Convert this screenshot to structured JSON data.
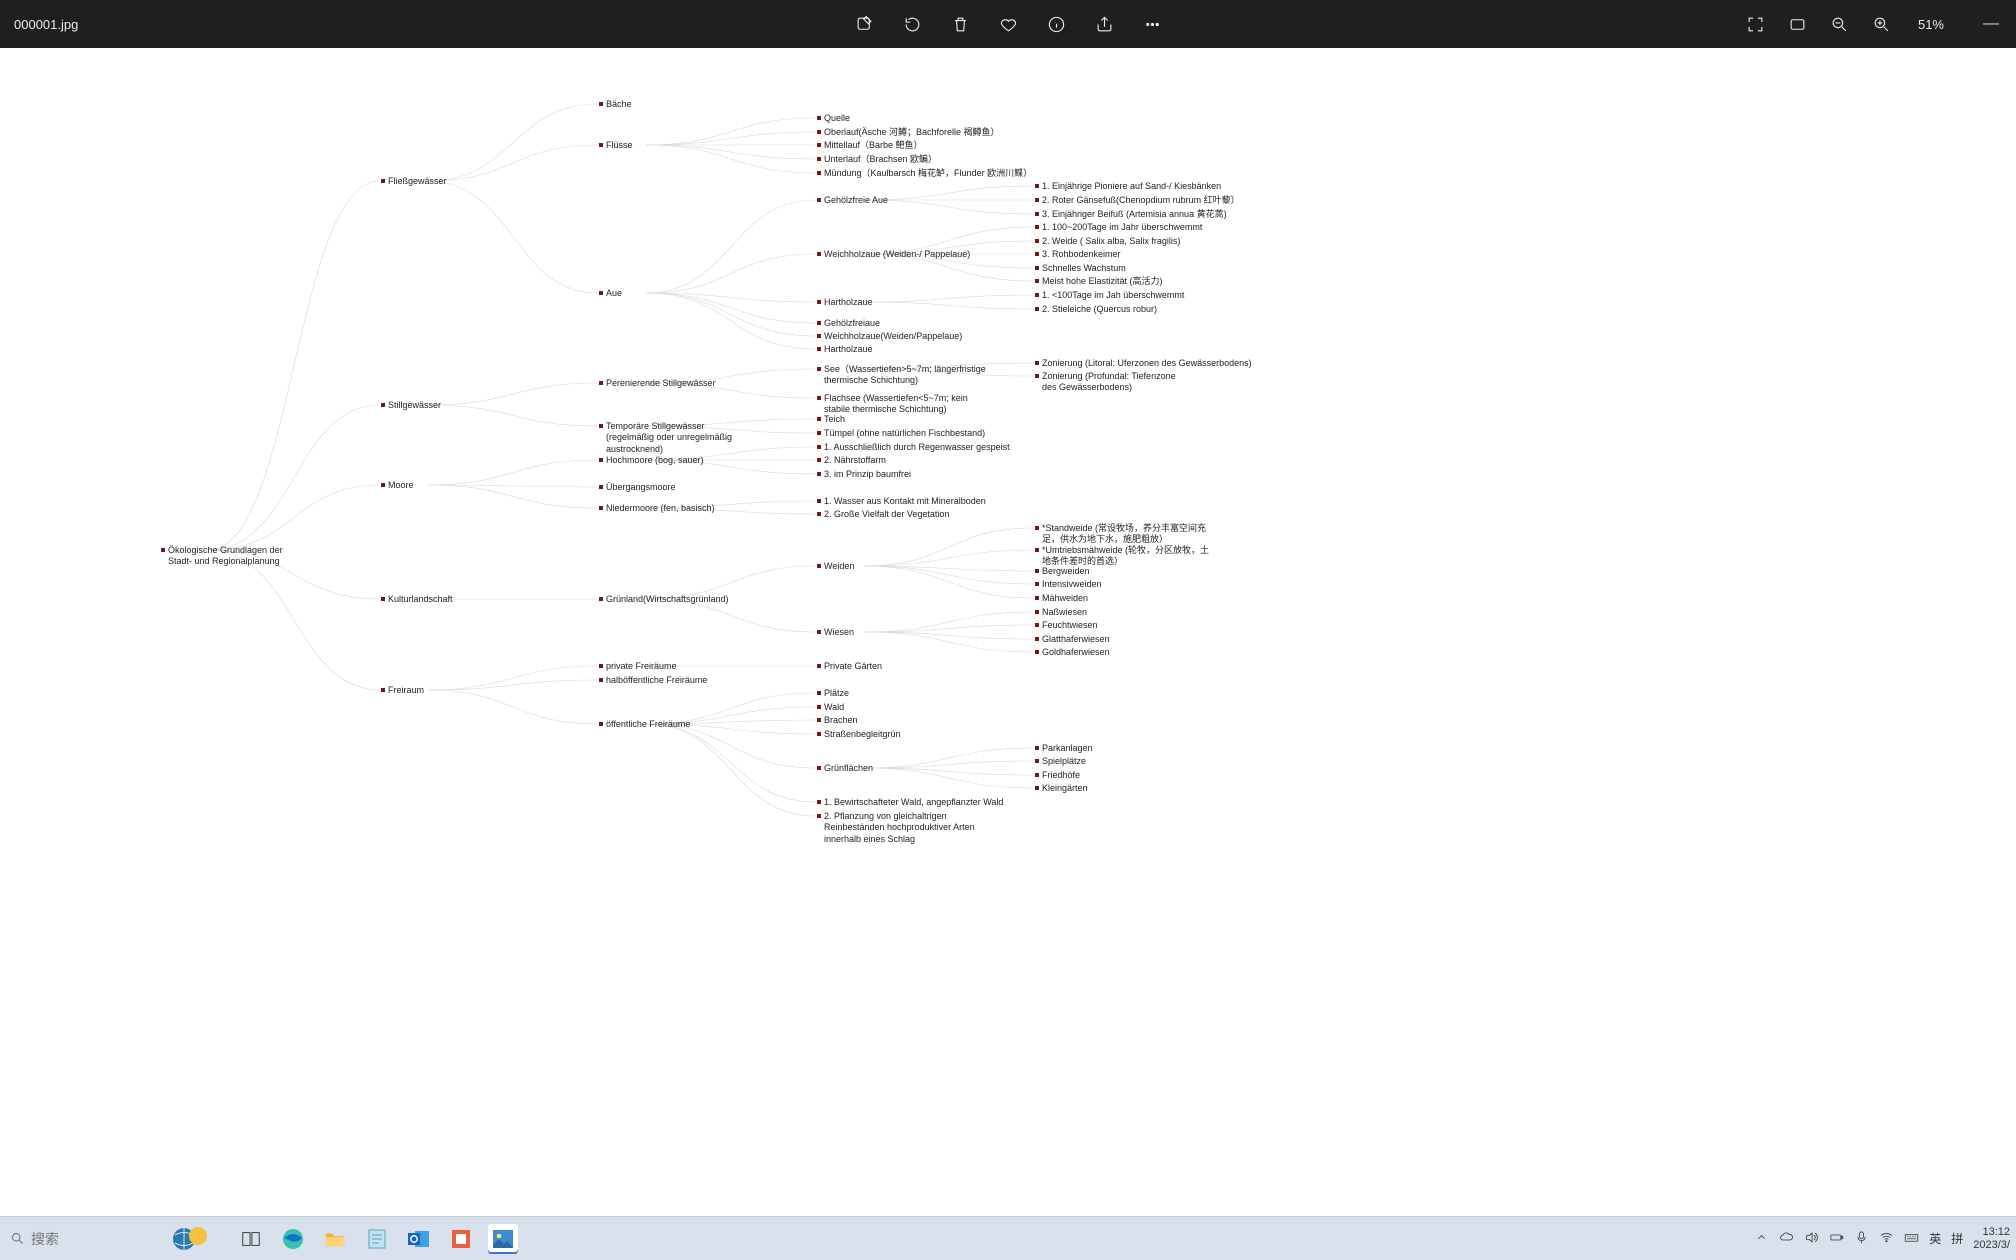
{
  "titlebar": {
    "filename": "000001.jpg",
    "zoom": "51%"
  },
  "taskbar": {
    "search_placeholder": "搜索",
    "time": "13:12",
    "date": "2023/3/",
    "ime_lang": "英",
    "ime_mode": "拼"
  },
  "mindmap": {
    "root": "Ökologische Grundlagen der Stadt- und Regionalplanung",
    "l1": {
      "fliess": "Fließgewässer",
      "still": "Stillgewässer",
      "moore": "Moore",
      "kultur": "Kulturlandschaft",
      "freiraum": "Freiraum"
    },
    "l2": {
      "baeche": "Bäche",
      "fluesse": "Flüsse",
      "aue": "Aue",
      "perenn": "Perenierende Stillgewässer",
      "tempor": "Temporäre Stillgewässer (regelmäßig oder unregelmäßig austrocknend)",
      "hoch": "Hochmoore (bog, sauer)",
      "ueber": "Übergangsmoore",
      "nieder": "Niedermoore (fen, basisch)",
      "gruen": "Grünland(Wirtschaftsgrünland)",
      "priv": "private Freiräume",
      "halb": "halböffentliche Freiräume",
      "oeff": "öffentliche Freiräume"
    },
    "l3": {
      "quelle": "Quelle",
      "oberlauf": "Oberlauf(Äsche 河鳟；Bachforelle 褐鳟鱼）",
      "mittellauf": "Mittellauf（Barbe 鲃鱼）",
      "unterlauf": "Unterlauf（Brachsen 欧鳊）",
      "muendung": "Mündung（Kaulbarsch 梅花鲈，Flunder 欧洲川鲽）",
      "gehoelzfrei": "Gehölzfreie Aue",
      "weichholz": "Weichholzaue (Weiden-/ Pappelaue)",
      "hartholz": "Hartholzaue",
      "gehoelzfrei2": "Gehölzfreiaue",
      "weichholz2": "Weichholzaue(Weiden/Pappelaue)",
      "hartholz2": "Hartholzaue",
      "see": "See（Wassertiefen>5~7m; längerfristige thermische Schichtung)",
      "flachsee": "Flachsee (Wassertiefen<5~7m; kein stabile thermische Schichtung)",
      "teich": "Teich",
      "tuempel": "Tümpel (ohne natürlichen Fischbestand)",
      "hm1": "1. Ausschließlich durch Regenwasser gespeist",
      "hm2": "2. Nährstoffarm",
      "hm3": "3. im Prinzip baumfrei",
      "nm1": "1. Wasser aus Kontakt mit Mineralboden",
      "nm2": "2. Große Vielfalt der Vegetation",
      "weiden": "Weiden",
      "wiesen": "Wiesen",
      "privgart": "Private Gärten",
      "plaetze": "Plätze",
      "wald": "Wald",
      "brachen": "Brachen",
      "strasse": "Straßenbegleitgrün",
      "gruenfl": "Grünflächen",
      "bw1": "1. Bewirtschafteter Wald, angepflanzter Wald",
      "bw2": "2. Pflanzung von gleichaltrigen Reinbeständen hochproduktiver Arten innerhalb eines Schlag"
    },
    "l4": {
      "gp1": "1. Einjährige Pioniere auf Sand-/ Kiesbänken",
      "gp2": "2. Roter Gänsefuß(Chenopdium rubrum 红叶藜）",
      "gp3": "3. Einjähriger Beifuß (Artemisia annua 黄花蒿)",
      "wh1": "1. 100~200Tage im Jahr überschwemmt",
      "wh2": "2. Weide ( Salix alba, Salix fragilis)",
      "wh3": "3. Rohbodenkeimer",
      "wh4": "Schnelles Wachstum",
      "wh5": "Meist hohe Elastizität (高活力)",
      "hh1": "1. <100Tage im Jah überschwemmt",
      "hh2": "2. Stieleiche (Quercus robur)",
      "see1": "Zonierung (Litoral: Uferzonen des Gewässerbodens)",
      "see2": "Zonierung (Profundal: Tiefenzone des Gewässerbodens)",
      "wd1": "*Standweide (常设牧场，养分丰富空间充足，供水为地下水，施肥粗放）",
      "wd2": "*Umtriebsmähweide (轮牧，分区放牧，土地条件差时的首选）",
      "wd3": "Bergweiden",
      "wd4": "Intensivweiden",
      "wd5": "Mähweiden",
      "ws1": "Naßwiesen",
      "ws2": "Feuchtwiesen",
      "ws3": "Glatthaferwiesen",
      "ws4": "Goldhaferwiesen",
      "gf1": "Parkanlagen",
      "gf2": "Spielplätze",
      "gf3": "Friedhöfe",
      "gf4": "Kleingärten"
    }
  }
}
